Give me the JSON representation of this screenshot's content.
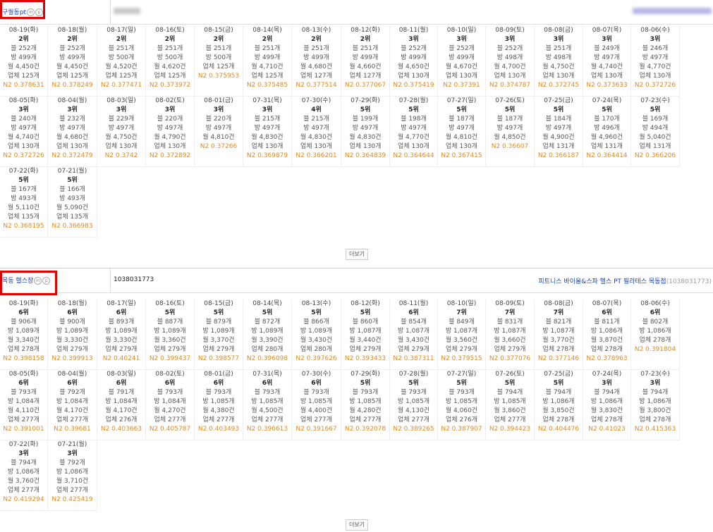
{
  "sections": [
    {
      "keyword": "구월동pt",
      "store_id": "",
      "store_name": "",
      "store_code": "",
      "more_label": "더보기",
      "cells": [
        {
          "date": "08-19(화)",
          "rank": "2위",
          "blog": "블 252개",
          "bang": "방 499개",
          "month": "월 4,450건",
          "biz": "업체 125개",
          "n2": "N2 0.378631"
        },
        {
          "date": "08-18(월)",
          "rank": "2위",
          "blog": "블 252개",
          "bang": "방 499개",
          "month": "월 4,450건",
          "biz": "업체 125개",
          "n2": "N2 0.378249"
        },
        {
          "date": "08-17(일)",
          "rank": "2위",
          "blog": "블 251개",
          "bang": "방 500개",
          "month": "월 4,520건",
          "biz": "업체 125개",
          "n2": "N2 0.377471"
        },
        {
          "date": "08-16(토)",
          "rank": "2위",
          "blog": "블 251개",
          "bang": "방 500개",
          "month": "월 4,620건",
          "biz": "업체 125개",
          "n2": "N2 0.373972"
        },
        {
          "date": "08-15(금)",
          "rank": "2위",
          "blog": "블 251개",
          "bang": "방 500개",
          "month": "업체 125개",
          "biz": "",
          "n2": "N2 0.375953"
        },
        {
          "date": "08-14(목)",
          "rank": "2위",
          "blog": "블 251개",
          "bang": "방 499개",
          "month": "월 4,710건",
          "biz": "업체 125개",
          "n2": "N2 0.375485"
        },
        {
          "date": "08-13(수)",
          "rank": "2위",
          "blog": "블 251개",
          "bang": "방 499개",
          "month": "월 4,680건",
          "biz": "업체 127개",
          "n2": "N2 0.377514"
        },
        {
          "date": "08-12(화)",
          "rank": "2위",
          "blog": "블 251개",
          "bang": "방 499개",
          "month": "월 4,660건",
          "biz": "업체 127개",
          "n2": "N2 0.377067"
        },
        {
          "date": "08-11(월)",
          "rank": "3위",
          "blog": "블 252개",
          "bang": "방 499개",
          "month": "월 4,650건",
          "biz": "업체 130개",
          "n2": "N2 0.375419"
        },
        {
          "date": "08-10(일)",
          "rank": "3위",
          "blog": "블 252개",
          "bang": "방 499개",
          "month": "월 4,670건",
          "biz": "업체 130개",
          "n2": "N2 0.37391"
        },
        {
          "date": "08-09(토)",
          "rank": "3위",
          "blog": "블 252개",
          "bang": "방 498개",
          "month": "월 4,700건",
          "biz": "업체 130개",
          "n2": "N2 0.374787"
        },
        {
          "date": "08-08(금)",
          "rank": "3위",
          "blog": "블 251개",
          "bang": "방 498개",
          "month": "월 4,750건",
          "biz": "업체 130개",
          "n2": "N2 0.372745"
        },
        {
          "date": "08-07(목)",
          "rank": "3위",
          "blog": "블 249개",
          "bang": "방 497개",
          "month": "월 4,740건",
          "biz": "업체 130개",
          "n2": "N2 0.373633"
        },
        {
          "date": "08-06(수)",
          "rank": "3위",
          "blog": "블 246개",
          "bang": "방 497개",
          "month": "월 4,770건",
          "biz": "업체 130개",
          "n2": "N2 0.372726"
        },
        {
          "date": "08-05(화)",
          "rank": "3위",
          "blog": "블 240개",
          "bang": "방 497개",
          "month": "월 4,740건",
          "biz": "업체 130개",
          "n2": "N2 0.372726"
        },
        {
          "date": "08-04(월)",
          "rank": "3위",
          "blog": "블 232개",
          "bang": "방 497개",
          "month": "월 4,680건",
          "biz": "업체 130개",
          "n2": "N2 0.372479"
        },
        {
          "date": "08-03(일)",
          "rank": "3위",
          "blog": "블 229개",
          "bang": "방 497개",
          "month": "월 4,750건",
          "biz": "업체 130개",
          "n2": "N2 0.3742"
        },
        {
          "date": "08-02(토)",
          "rank": "3위",
          "blog": "블 220개",
          "bang": "방 497개",
          "month": "월 4,790건",
          "biz": "업체 130개",
          "n2": "N2 0.372892"
        },
        {
          "date": "08-01(금)",
          "rank": "3위",
          "blog": "블 220개",
          "bang": "방 497개",
          "month": "월 4,810건",
          "biz": "",
          "n2": "N2 0.37266"
        },
        {
          "date": "07-31(목)",
          "rank": "3위",
          "blog": "블 215개",
          "bang": "방 497개",
          "month": "월 4,830건",
          "biz": "업체 130개",
          "n2": "N2 0.369879"
        },
        {
          "date": "07-30(수)",
          "rank": "4위",
          "blog": "블 215개",
          "bang": "방 497개",
          "month": "월 4,830건",
          "biz": "업체 130개",
          "n2": "N2 0.366201"
        },
        {
          "date": "07-29(화)",
          "rank": "5위",
          "blog": "블 199개",
          "bang": "방 497개",
          "month": "월 4,830건",
          "biz": "업체 130개",
          "n2": "N2 0.364839"
        },
        {
          "date": "07-28(월)",
          "rank": "5위",
          "blog": "블 198개",
          "bang": "방 497개",
          "month": "월 4,770건",
          "biz": "업체 130개",
          "n2": "N2 0.364644"
        },
        {
          "date": "07-27(일)",
          "rank": "5위",
          "blog": "블 187개",
          "bang": "방 497개",
          "month": "월 4,810건",
          "biz": "업체 130개",
          "n2": "N2 0.367415"
        },
        {
          "date": "07-26(토)",
          "rank": "5위",
          "blog": "블 187개",
          "bang": "방 497개",
          "month": "월 4,850건",
          "biz": "",
          "n2": "N2 0.36607"
        },
        {
          "date": "07-25(금)",
          "rank": "5위",
          "blog": "블 184개",
          "bang": "방 497개",
          "month": "월 4,900건",
          "biz": "업체 131개",
          "n2": "N2 0.366187"
        },
        {
          "date": "07-24(목)",
          "rank": "5위",
          "blog": "블 170개",
          "bang": "방 496개",
          "month": "월 4,960건",
          "biz": "업체 131개",
          "n2": "N2 0.364414"
        },
        {
          "date": "07-23(수)",
          "rank": "5위",
          "blog": "블 169개",
          "bang": "방 494개",
          "month": "월 5,040건",
          "biz": "업체 131개",
          "n2": "N2 0.366206"
        },
        {
          "date": "07-22(화)",
          "rank": "5위",
          "blog": "블 167개",
          "bang": "방 493개",
          "month": "월 5,110건",
          "biz": "업체 135개",
          "n2": "N2 0.368195"
        },
        {
          "date": "07-21(월)",
          "rank": "5위",
          "blog": "블 166개",
          "bang": "방 493개",
          "month": "월 5,090건",
          "biz": "업체 135개",
          "n2": "N2 0.366983"
        }
      ]
    },
    {
      "keyword": "목동 헬스장",
      "store_id": "1038031773",
      "store_name": "피트니스 바이올&스파 헬스 PT 필라테스 목동점",
      "store_code": "(1038031773)",
      "more_label": "더보기",
      "cells": [
        {
          "date": "08-19(화)",
          "rank": "6위",
          "blog": "블 906개",
          "bang": "방 1,089개",
          "month": "월 3,340건",
          "biz": "업체 278개",
          "n2": "N2 0.398158"
        },
        {
          "date": "08-18(월)",
          "rank": "6위",
          "blog": "블 900개",
          "bang": "방 1,089개",
          "month": "월 3,330건",
          "biz": "업체 279개",
          "n2": "N2 0.399913"
        },
        {
          "date": "08-17(일)",
          "rank": "6위",
          "blog": "블 893개",
          "bang": "방 1,089개",
          "month": "월 3,330건",
          "biz": "업체 279개",
          "n2": "N2 0.40241"
        },
        {
          "date": "08-16(토)",
          "rank": "5위",
          "blog": "블 887개",
          "bang": "방 1,089개",
          "month": "월 3,360건",
          "biz": "업체 279개",
          "n2": "N2 0.399437"
        },
        {
          "date": "08-15(금)",
          "rank": "5위",
          "blog": "블 879개",
          "bang": "방 1,089개",
          "month": "월 3,370건",
          "biz": "업체 279개",
          "n2": "N2 0.398577"
        },
        {
          "date": "08-14(목)",
          "rank": "5위",
          "blog": "블 872개",
          "bang": "방 1,089개",
          "month": "월 3,390건",
          "biz": "업체 280개",
          "n2": "N2 0.396098"
        },
        {
          "date": "08-13(수)",
          "rank": "5위",
          "blog": "블 866개",
          "bang": "방 1,089개",
          "month": "월 3,430건",
          "biz": "업체 280개",
          "n2": "N2 0.397626"
        },
        {
          "date": "08-12(화)",
          "rank": "5위",
          "blog": "블 860개",
          "bang": "방 1,087개",
          "month": "월 3,440건",
          "biz": "업체 279개",
          "n2": "N2 0.393433"
        },
        {
          "date": "08-11(월)",
          "rank": "6위",
          "blog": "블 854개",
          "bang": "방 1,087개",
          "month": "월 3,430건",
          "biz": "업체 279개",
          "n2": "N2 0.387311"
        },
        {
          "date": "08-10(일)",
          "rank": "7위",
          "blog": "블 849개",
          "bang": "방 1,087개",
          "month": "월 3,560건",
          "biz": "업체 279개",
          "n2": "N2 0.379515"
        },
        {
          "date": "08-09(토)",
          "rank": "7위",
          "blog": "블 831개",
          "bang": "방 1,087개",
          "month": "월 3,660건",
          "biz": "업체 279개",
          "n2": "N2 0.377076"
        },
        {
          "date": "08-08(금)",
          "rank": "7위",
          "blog": "블 821개",
          "bang": "방 1,087개",
          "month": "월 3,770건",
          "biz": "업체 278개",
          "n2": "N2 0.377146"
        },
        {
          "date": "08-07(목)",
          "rank": "6위",
          "blog": "블 811개",
          "bang": "방 1,086개",
          "month": "월 3,870건",
          "biz": "업체 278개",
          "n2": "N2 0.378963"
        },
        {
          "date": "08-06(수)",
          "rank": "6위",
          "blog": "블 802개",
          "bang": "방 1,086개",
          "month": "업체 278개",
          "biz": "",
          "n2": "N2 0.391804"
        },
        {
          "date": "08-05(화)",
          "rank": "6위",
          "blog": "블 793개",
          "bang": "방 1,084개",
          "month": "월 4,110건",
          "biz": "업체 277개",
          "n2": "N2 0.391001"
        },
        {
          "date": "08-04(월)",
          "rank": "6위",
          "blog": "블 792개",
          "bang": "방 1,084개",
          "month": "월 4,170건",
          "biz": "업체 277개",
          "n2": "N2 0.39681"
        },
        {
          "date": "08-03(일)",
          "rank": "6위",
          "blog": "블 791개",
          "bang": "방 1,084개",
          "month": "월 4,170건",
          "biz": "업체 276개",
          "n2": "N2 0.403663"
        },
        {
          "date": "08-02(토)",
          "rank": "6위",
          "blog": "블 793개",
          "bang": "방 1,084개",
          "month": "월 4,270건",
          "biz": "업체 277개",
          "n2": "N2 0.405787"
        },
        {
          "date": "08-01(금)",
          "rank": "6위",
          "blog": "블 793개",
          "bang": "방 1,085개",
          "month": "월 4,380건",
          "biz": "업체 277개",
          "n2": "N2 0.403493"
        },
        {
          "date": "07-31(목)",
          "rank": "6위",
          "blog": "블 793개",
          "bang": "방 1,085개",
          "month": "월 4,500건",
          "biz": "업체 277개",
          "n2": "N2 0.396613"
        },
        {
          "date": "07-30(수)",
          "rank": "6위",
          "blog": "블 793개",
          "bang": "방 1,085개",
          "month": "월 4,400건",
          "biz": "업체 277개",
          "n2": "N2 0.391667"
        },
        {
          "date": "07-29(화)",
          "rank": "5위",
          "blog": "블 793개",
          "bang": "방 1,085개",
          "month": "월 4,280건",
          "biz": "업체 277개",
          "n2": "N2 0.392078"
        },
        {
          "date": "07-28(월)",
          "rank": "5위",
          "blog": "블 793개",
          "bang": "방 1,085개",
          "month": "월 4,130건",
          "biz": "업체 277개",
          "n2": "N2 0.389265"
        },
        {
          "date": "07-27(일)",
          "rank": "5위",
          "blog": "블 793개",
          "bang": "방 1,085개",
          "month": "월 4,060건",
          "biz": "업체 276개",
          "n2": "N2 0.387907"
        },
        {
          "date": "07-26(토)",
          "rank": "5위",
          "blog": "블 794개",
          "bang": "방 1,085개",
          "month": "월 3,860건",
          "biz": "업체 277개",
          "n2": "N2 0.394423"
        },
        {
          "date": "07-25(금)",
          "rank": "5위",
          "blog": "블 794개",
          "bang": "방 1,086개",
          "month": "월 3,850건",
          "biz": "업체 278개",
          "n2": "N2 0.404476"
        },
        {
          "date": "07-24(목)",
          "rank": "3위",
          "blog": "블 794개",
          "bang": "방 1,086개",
          "month": "월 3,830건",
          "biz": "업체 278개",
          "n2": "N2 0.41023"
        },
        {
          "date": "07-23(수)",
          "rank": "3위",
          "blog": "블 794개",
          "bang": "방 1,086개",
          "month": "월 3,800건",
          "biz": "업체 278개",
          "n2": "N2 0.415363"
        },
        {
          "date": "07-22(화)",
          "rank": "3위",
          "blog": "블 794개",
          "bang": "방 1,086개",
          "month": "월 3,760건",
          "biz": "업체 277개",
          "n2": "N2 0.419294"
        },
        {
          "date": "07-21(월)",
          "rank": "3위",
          "blog": "블 792개",
          "bang": "방 1,086개",
          "month": "월 3,710건",
          "biz": "업체 277개",
          "n2": "N2 0.425419"
        }
      ]
    }
  ],
  "colors": {
    "accent": "#1a3fb5",
    "n2": "#e08a1e",
    "highlight": "#e00000"
  }
}
